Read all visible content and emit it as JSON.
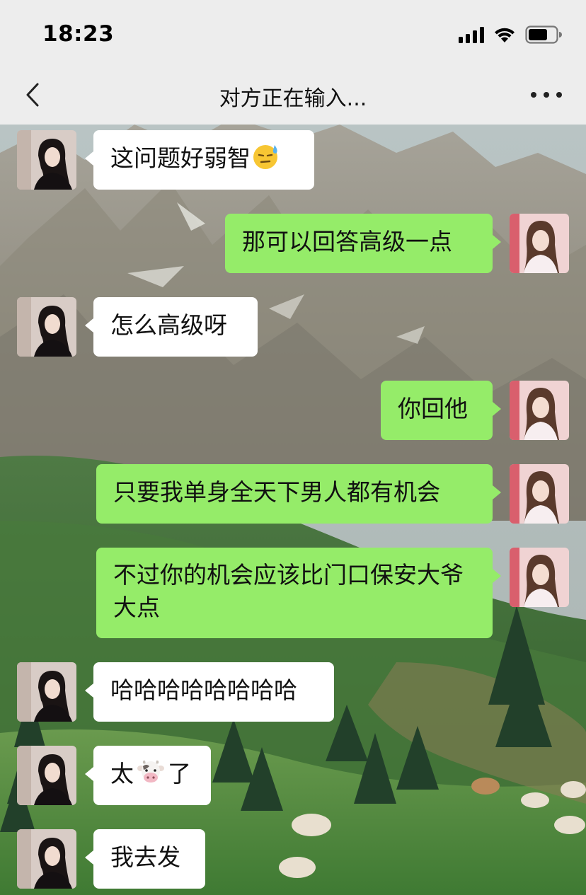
{
  "status_bar": {
    "time": "18:23"
  },
  "nav": {
    "title": "对方正在输入...",
    "back_icon": "chevron-left-icon",
    "more_icon": "more-dots-icon"
  },
  "colors": {
    "chrome_bg": "#ededed",
    "bubble_sent": "#95ec69",
    "bubble_received": "#ffffff"
  },
  "messages": [
    {
      "side": "left",
      "text": "这问题好弱智",
      "emoji": "sweat-smile-emoji"
    },
    {
      "side": "right",
      "text": "那可以回答高级一点"
    },
    {
      "side": "left",
      "text": "怎么高级呀"
    },
    {
      "side": "right",
      "text": "你回他"
    },
    {
      "side": "right",
      "text": "只要我单身全天下男人都有机会"
    },
    {
      "side": "right",
      "text": "不过你的机会应该比门口保安大爷大点"
    },
    {
      "side": "left",
      "text": "哈哈哈哈哈哈哈哈"
    },
    {
      "side": "left",
      "text_before": "太",
      "emoji": "cow-face-emoji",
      "text_after": "了"
    },
    {
      "side": "left",
      "text": "我去发"
    }
  ]
}
